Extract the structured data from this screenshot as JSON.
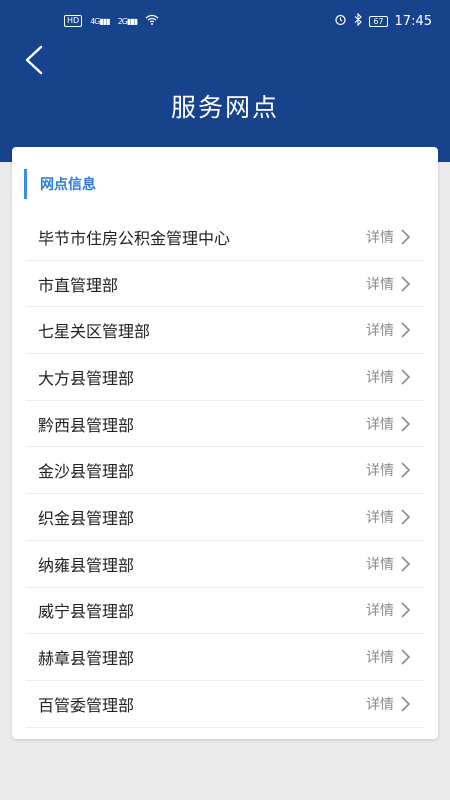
{
  "status_bar": {
    "left": [
      "HD",
      "4G",
      "2G"
    ],
    "battery": "67",
    "time": "17:45"
  },
  "header": {
    "title": "服务网点"
  },
  "section": {
    "title": "网点信息"
  },
  "items": [
    {
      "name": "毕节市住房公积金管理中心",
      "detail": "详情"
    },
    {
      "name": "市直管理部",
      "detail": "详情"
    },
    {
      "name": "七星关区管理部",
      "detail": "详情"
    },
    {
      "name": "大方县管理部",
      "detail": "详情"
    },
    {
      "name": "黔西县管理部",
      "detail": "详情"
    },
    {
      "name": "金沙县管理部",
      "detail": "详情"
    },
    {
      "name": "织金县管理部",
      "detail": "详情"
    },
    {
      "name": "纳雍县管理部",
      "detail": "详情"
    },
    {
      "name": "威宁县管理部",
      "detail": "详情"
    },
    {
      "name": "赫章县管理部",
      "detail": "详情"
    },
    {
      "name": "百管委管理部",
      "detail": "详情"
    }
  ],
  "colors": {
    "header_bg": "#17438c",
    "accent": "#3c8de6",
    "page_bg": "#ebebeb"
  }
}
